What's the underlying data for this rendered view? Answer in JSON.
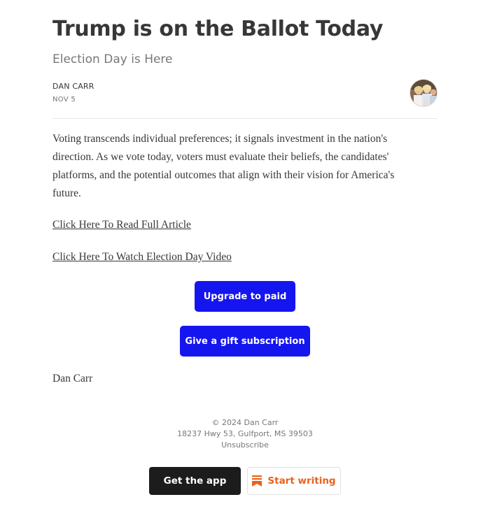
{
  "post": {
    "title": "Trump is on the Ballot Today",
    "subtitle": "Election Day is Here",
    "author": "DAN CARR",
    "date": "NOV 5",
    "body": "Voting transcends individual preferences; it signals investment in the nation's direction. As we vote today, voters must evaluate their beliefs, the candidates' platforms, and the potential outcomes that align with their vision for America's future.",
    "link_read": "Click Here To Read Full Article",
    "link_video": "Click Here To Watch Election Day Video",
    "signature": "Dan Carr"
  },
  "buttons": {
    "upgrade": "Upgrade to paid",
    "gift": "Give a gift subscription",
    "app": "Get the app",
    "write": "Start writing"
  },
  "footer": {
    "copyright": "© 2024 Dan Carr",
    "address": "18237 Hwy 53, Gulfport, MS 39503",
    "unsubscribe": "Unsubscribe"
  },
  "icons": {
    "write_icon": "substack-bookmark-icon",
    "avatar": "author-avatar"
  },
  "colors": {
    "accent_blue": "#1515f0",
    "app_button": "#1c1c1c",
    "write_orange": "#e8621b",
    "text": "#363737",
    "muted": "#777777"
  }
}
